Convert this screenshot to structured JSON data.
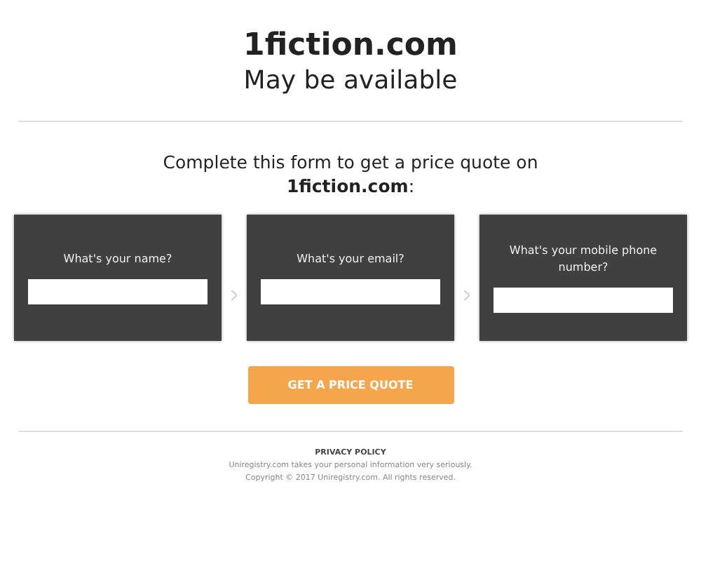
{
  "header": {
    "domain": "1fiction.com",
    "status": "May be available"
  },
  "intro": "Complete this form to get a price quote on **1fiction.com**:",
  "fields": [
    {
      "label": "What's your name?"
    },
    {
      "label": "What's your email?"
    },
    {
      "label": "What's your mobile phone number?"
    }
  ],
  "submit": "GET A PRICE QUOTE",
  "footer": {
    "link": "PRIVACY POLICY",
    "lines": [
      "Uniregistry.com takes your personal information very seriously.",
      "Copyright © 2017 Uniregistry.com. All rights reserved."
    ]
  }
}
